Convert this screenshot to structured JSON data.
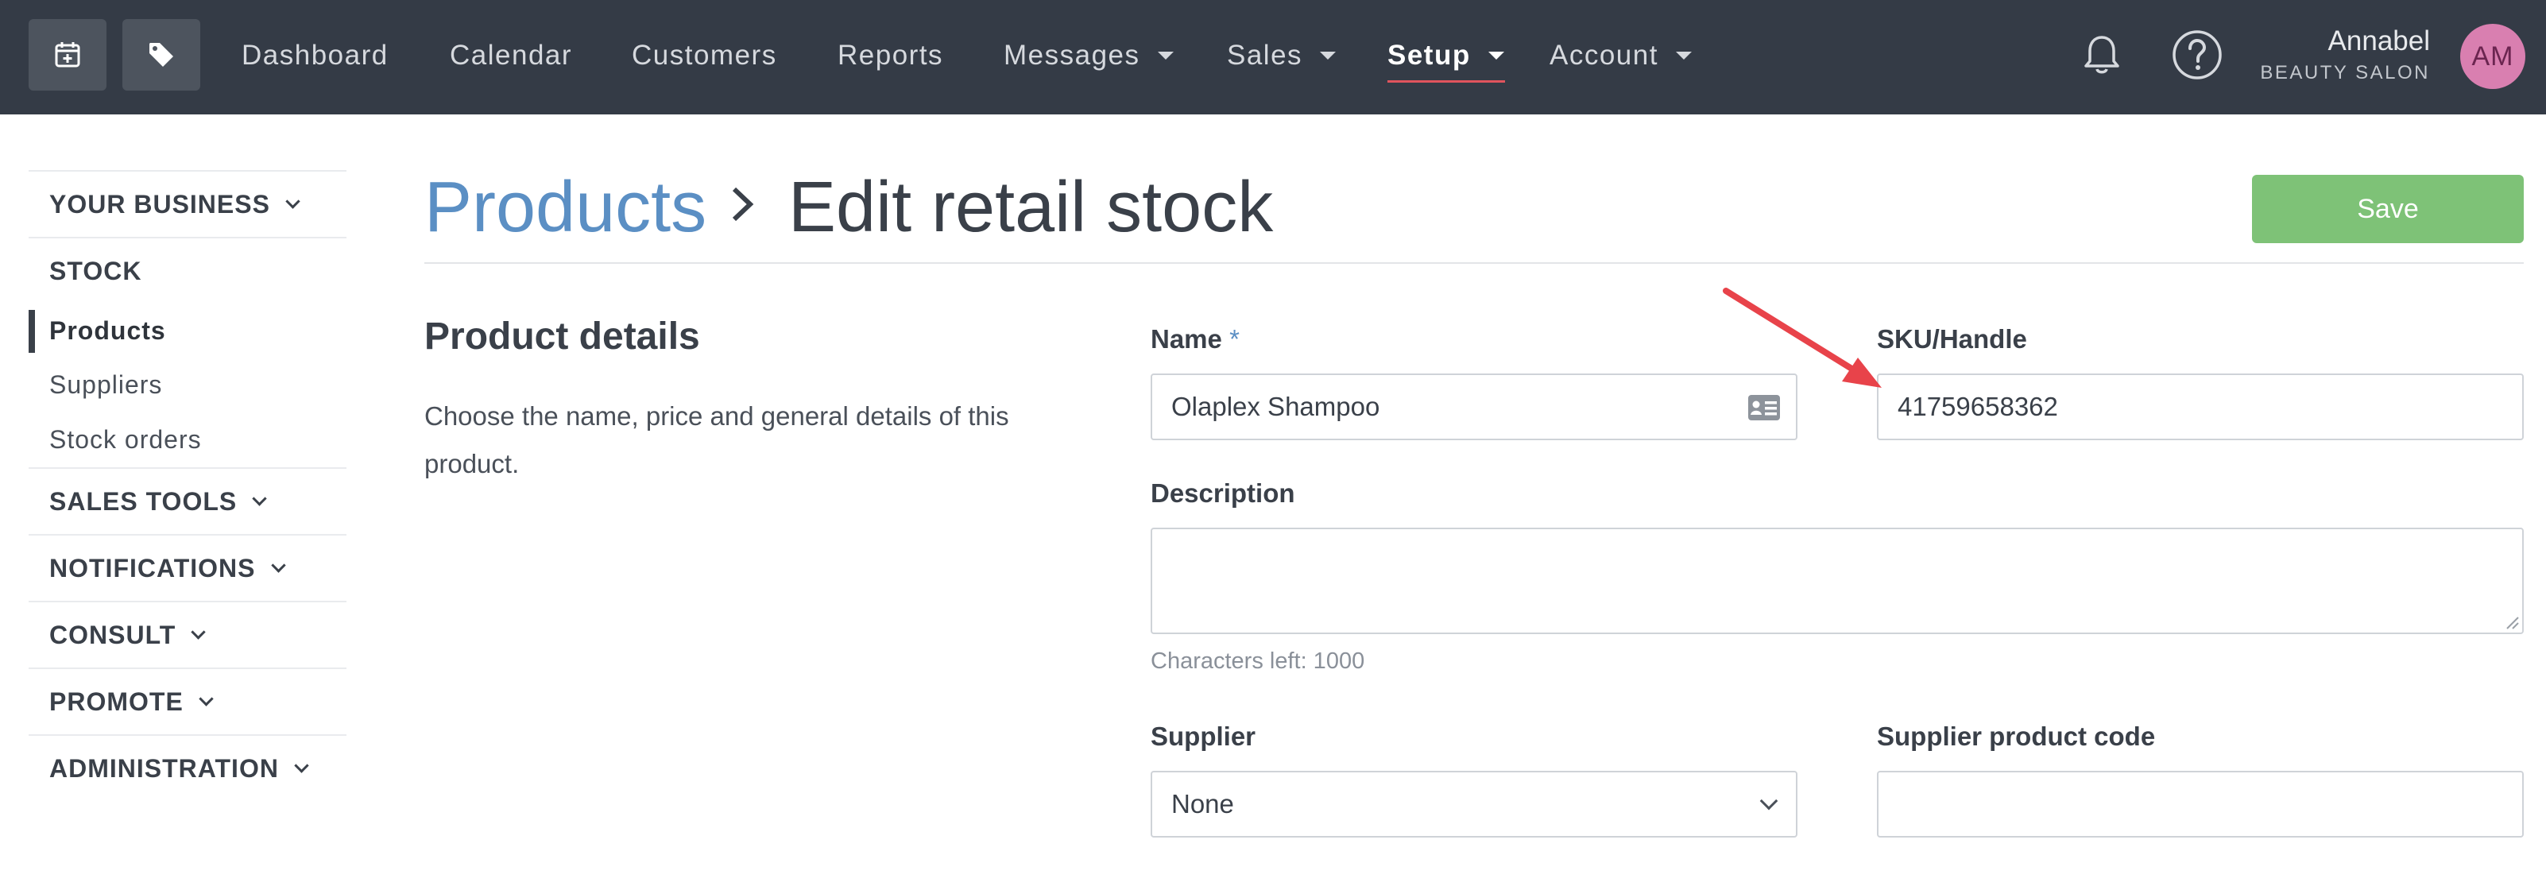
{
  "topbar": {
    "nav": [
      "Dashboard",
      "Calendar",
      "Customers",
      "Reports",
      "Messages",
      "Sales",
      "Setup",
      "Account"
    ],
    "user": {
      "name": "Annabel",
      "business": "BEAUTY SALON",
      "initials": "AM"
    },
    "icons": [
      "calendar-plus-icon",
      "tag-icon",
      "bell-icon",
      "help-icon"
    ]
  },
  "sidebar": {
    "your_business": "YOUR BUSINESS",
    "stock": "STOCK",
    "stock_items": [
      "Products",
      "Suppliers",
      "Stock orders"
    ],
    "sales_tools": "SALES TOOLS",
    "notifications": "NOTIFICATIONS",
    "consult": "CONSULT",
    "promote": "PROMOTE",
    "administration": "ADMINISTRATION"
  },
  "header": {
    "breadcrumb_link": "Products",
    "title": "Edit retail stock",
    "save_label": "Save"
  },
  "details": {
    "title": "Product details",
    "description": "Choose the name, price and general details of this product."
  },
  "form": {
    "name_label": "Name",
    "name_required": "*",
    "name_value": "Olaplex Shampoo",
    "sku_label": "SKU/Handle",
    "sku_value": "41759658362",
    "description_label": "Description",
    "description_value": "",
    "chars_left": "Characters left: 1000",
    "supplier_label": "Supplier",
    "supplier_value": "None",
    "supplier_code_label": "Supplier product code",
    "supplier_code_value": ""
  },
  "colors": {
    "topbar": "#343b46",
    "accent_link": "#5b8fc4",
    "save_green": "#7ec277",
    "active_underline": "#e0545d",
    "avatar": "#d97fb0",
    "annotation_arrow": "#e8434a"
  }
}
